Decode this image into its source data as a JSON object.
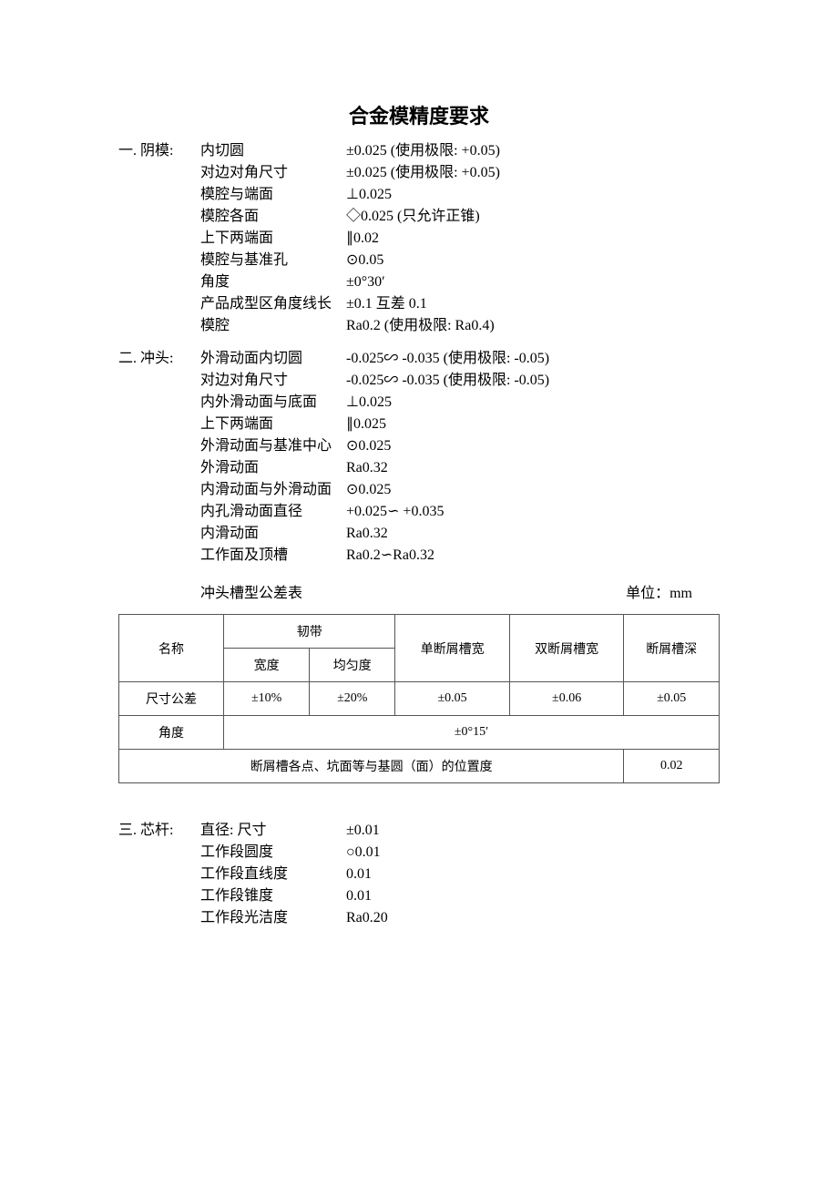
{
  "title": "合金模精度要求",
  "section1": {
    "label": "一. 阴模:",
    "rows": [
      {
        "c1": "内切圆",
        "c2": "±0.025   (使用极限:    +0.05)"
      },
      {
        "c1": "对边对角尺寸",
        "c2": "±0.025   (使用极限:    +0.05)"
      },
      {
        "c1": "模腔与端面",
        "c2": "⊥0.025"
      },
      {
        "c1": "模腔各面",
        "c2": "◇0.025   (只允许正锥)"
      },
      {
        "c1": "上下两端面",
        "c2": "∥0.02"
      },
      {
        "c1": "模腔与基准孔",
        "c2": "⊙0.05"
      },
      {
        "c1": "角度",
        "c2": " ±0°30′"
      },
      {
        "c1": "产品成型区角度线长",
        "c2": " ±0.1    互差 0.1"
      },
      {
        "c1": "模腔",
        "c2": " Ra0.2     (使用极限: Ra0.4)"
      }
    ]
  },
  "section2": {
    "label": "二. 冲头:",
    "rows": [
      {
        "c1": "外滑动面内切圆",
        "c2": "-0.025∽ -0.035   (使用极限:    -0.05)"
      },
      {
        "c1": "对边对角尺寸",
        "c2": "-0.025∽ -0.035   (使用极限:    -0.05)"
      },
      {
        "c1": "内外滑动面与底面",
        "c2": "⊥0.025"
      },
      {
        "c1": "上下两端面",
        "c2": "∥0.025"
      },
      {
        "c1": "外滑动面与基准中心",
        "c2": "⊙0.025"
      },
      {
        "c1": "外滑动面",
        "c2": "Ra0.32"
      },
      {
        "c1": "内滑动面与外滑动面",
        "c2": "⊙0.025"
      },
      {
        "c1": "内孔滑动面直径",
        "c2": "+0.025∽ +0.035"
      },
      {
        "c1": "内滑动面",
        "c2": "Ra0.32"
      },
      {
        "c1": "工作面及顶槽",
        "c2": "Ra0.2∽Ra0.32"
      }
    ]
  },
  "tableHeader": {
    "title": "冲头槽型公差表",
    "unit": "单位：mm"
  },
  "table": {
    "colName": "名称",
    "colRD": "韧带",
    "colRDWidth": "宽度",
    "colRDUniform": "均匀度",
    "colSingle": "单断屑槽宽",
    "colDouble": "双断屑槽宽",
    "colDepth": "断屑槽深",
    "rowSize": "尺寸公差",
    "sizeRDW": "±10%",
    "sizeRDU": "±20%",
    "sizeSingle": "±0.05",
    "sizeDouble": "±0.06",
    "sizeDepth": "±0.05",
    "rowAngle": "角度",
    "angleVal": "±0°15′",
    "rowPos": "断屑槽各点、坑面等与基圆（面）的位置度",
    "posVal": "0.02"
  },
  "section3": {
    "label": "三. 芯杆:",
    "rows": [
      {
        "c1": "直径:   尺寸",
        "c2": "±0.01"
      },
      {
        "c1": "工作段圆度",
        "c2": "○0.01"
      },
      {
        "c1": "工作段直线度",
        "c2": "0.01"
      },
      {
        "c1": "工作段锥度",
        "c2": "0.01"
      },
      {
        "c1": "工作段光洁度",
        "c2": "Ra0.20"
      }
    ]
  }
}
